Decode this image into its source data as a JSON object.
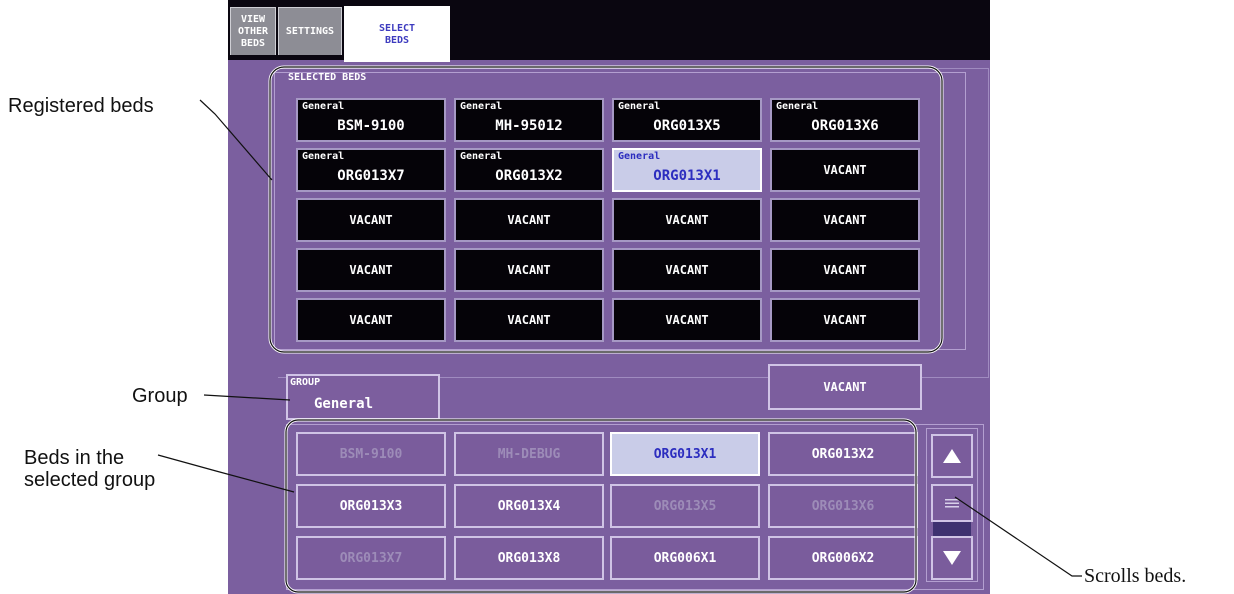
{
  "tabs": [
    {
      "label": "VIEW\nOTHER BEDS",
      "active": false
    },
    {
      "label": "SETTINGS",
      "active": false
    },
    {
      "label": "SELECT\nBEDS",
      "active": true
    }
  ],
  "selected_beds": {
    "section_label": "SELECTED BEDS",
    "beds": [
      {
        "group": "General",
        "name": "BSM-9100"
      },
      {
        "group": "General",
        "name": "MH-95012"
      },
      {
        "group": "General",
        "name": "ORG013X5"
      },
      {
        "group": "General",
        "name": "ORG013X6"
      },
      {
        "group": "General",
        "name": "ORG013X7"
      },
      {
        "group": "General",
        "name": "ORG013X2"
      },
      {
        "group": "General",
        "name": "ORG013X1",
        "highlighted": true
      },
      {
        "group": "",
        "name": "VACANT"
      },
      {
        "group": "",
        "name": "VACANT"
      },
      {
        "group": "",
        "name": "VACANT"
      },
      {
        "group": "",
        "name": "VACANT"
      },
      {
        "group": "",
        "name": "VACANT"
      },
      {
        "group": "",
        "name": "VACANT"
      },
      {
        "group": "",
        "name": "VACANT"
      },
      {
        "group": "",
        "name": "VACANT"
      },
      {
        "group": "",
        "name": "VACANT"
      },
      {
        "group": "",
        "name": "VACANT"
      },
      {
        "group": "",
        "name": "VACANT"
      },
      {
        "group": "",
        "name": "VACANT"
      },
      {
        "group": "",
        "name": "VACANT"
      }
    ]
  },
  "group_selector": {
    "label": "GROUP",
    "value": "General"
  },
  "vacant_button": {
    "label": "VACANT"
  },
  "group_beds": [
    {
      "name": "BSM-9100",
      "state": "dim"
    },
    {
      "name": "MH-DEBUG",
      "state": "dim"
    },
    {
      "name": "ORG013X1",
      "state": "highlighted"
    },
    {
      "name": "ORG013X2",
      "state": "active"
    },
    {
      "name": "ORG013X3",
      "state": "active"
    },
    {
      "name": "ORG013X4",
      "state": "active"
    },
    {
      "name": "ORG013X5",
      "state": "dim"
    },
    {
      "name": "ORG013X6",
      "state": "dim"
    },
    {
      "name": "ORG013X7",
      "state": "dim"
    },
    {
      "name": "ORG013X8",
      "state": "active"
    },
    {
      "name": "ORG006X1",
      "state": "active"
    },
    {
      "name": "ORG006X2",
      "state": "active"
    }
  ],
  "scroll": {
    "up_icon": "triangle-up-icon",
    "thumb_icon": "scroll-thumb-icon",
    "down_icon": "triangle-down-icon"
  },
  "annotations": {
    "registered_beds": "Registered beds",
    "group": "Group",
    "beds_in_group_line1": "Beds in the",
    "beds_in_group_line2": "selected group",
    "scrolls_beds": "Scrolls beds."
  },
  "colors": {
    "screen_bg": "#7b5f9f",
    "bed_cell_bg": "#050308",
    "highlight_bg": "#c9cce8",
    "highlight_text": "#2c2dbf",
    "dim_text": "#9d8cb8"
  }
}
